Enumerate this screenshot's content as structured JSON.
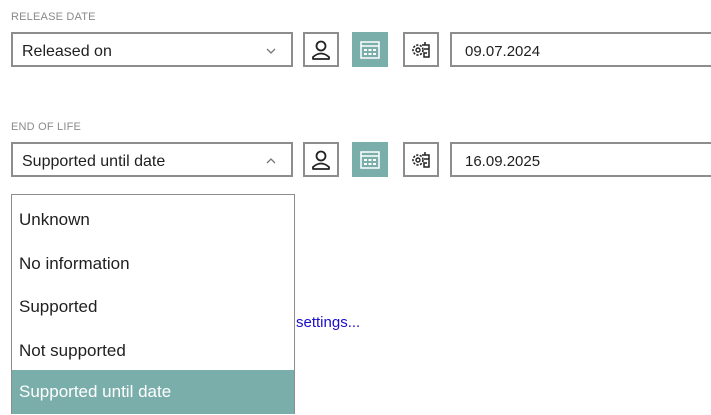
{
  "release": {
    "label": "RELEASE DATE",
    "selected": "Released on",
    "date": "09.07.2024"
  },
  "eol": {
    "label": "END OF LIFE",
    "selected": "Supported until date",
    "date": "16.09.2025",
    "options": [
      "Unknown",
      "No information",
      "Supported",
      "Not supported",
      "Supported until date"
    ],
    "selected_index": 4
  },
  "link": {
    "text": "settings..."
  },
  "icons": {
    "person": "person-icon",
    "calendar": "calendar-icon",
    "automatic": "gear-hand-icon"
  },
  "colors": {
    "accent": "#7aaeaa",
    "border": "#8d8d8d",
    "link": "#1a0dcc",
    "label": "#8a8a8a"
  }
}
